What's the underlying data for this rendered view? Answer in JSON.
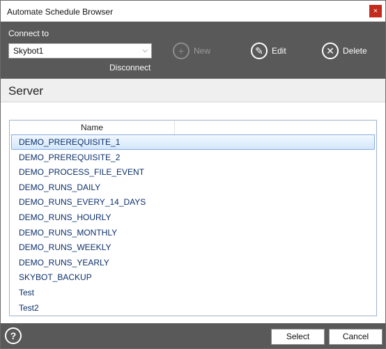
{
  "window": {
    "title": "Automate Schedule Browser",
    "close_glyph": "×"
  },
  "toolbar": {
    "connect_label": "Connect to",
    "connect_value": "Skybot1",
    "disconnect_label": "Disconnect",
    "new_label": "New",
    "new_enabled": false,
    "edit_label": "Edit",
    "delete_label": "Delete",
    "icons": {
      "new": "plus-circle-icon",
      "edit": "pencil-circle-icon",
      "delete": "x-circle-icon"
    }
  },
  "server": {
    "header": "Server"
  },
  "list": {
    "column_name": "Name",
    "selected_index": 0,
    "rows": [
      "DEMO_PREREQUISITE_1",
      "DEMO_PREREQUISITE_2",
      "DEMO_PROCESS_FILE_EVENT",
      "DEMO_RUNS_DAILY",
      "DEMO_RUNS_EVERY_14_DAYS",
      "DEMO_RUNS_HOURLY",
      "DEMO_RUNS_MONTHLY",
      "DEMO_RUNS_WEEKLY",
      "DEMO_RUNS_YEARLY",
      "SKYBOT_BACKUP",
      "Test",
      "Test2"
    ]
  },
  "footer": {
    "help_glyph": "?",
    "select_label": "Select",
    "cancel_label": "Cancel"
  },
  "colors": {
    "toolbar_bg": "#595959",
    "close_red": "#c42b1c",
    "row_text": "#0b2f6b",
    "selection_border": "#84acdd"
  }
}
